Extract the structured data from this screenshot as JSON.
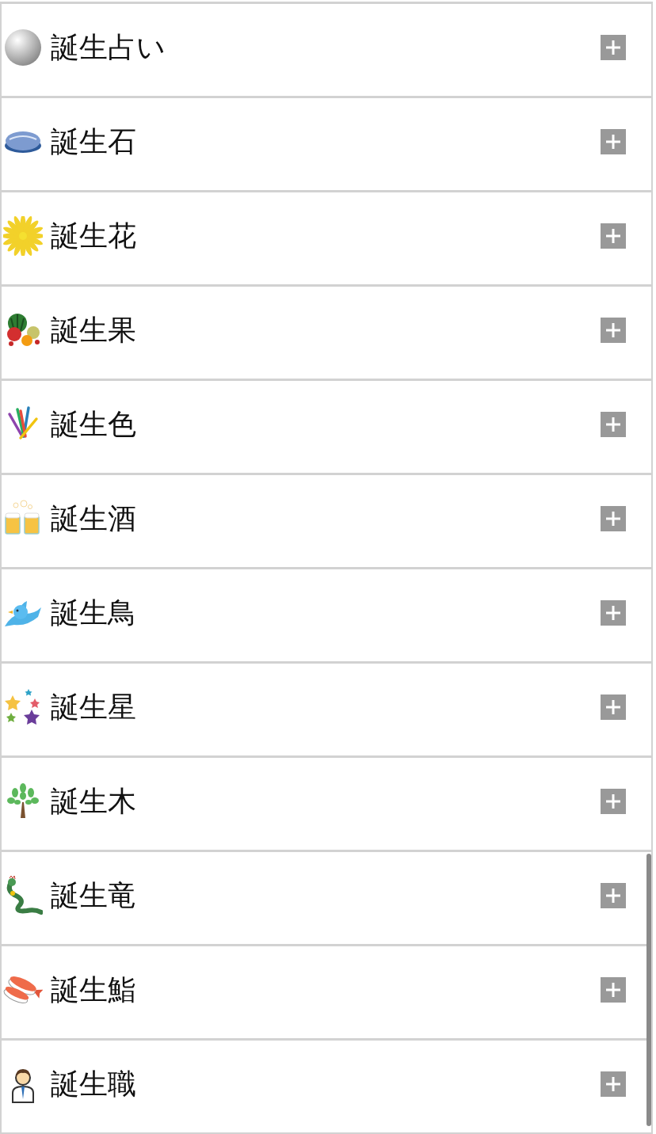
{
  "items": [
    {
      "label": "誕生占い",
      "expanded": false
    },
    {
      "label": "誕生石",
      "expanded": false
    },
    {
      "label": "誕生花",
      "expanded": false
    },
    {
      "label": "誕生果",
      "expanded": false
    },
    {
      "label": "誕生色",
      "expanded": false
    },
    {
      "label": "誕生酒",
      "expanded": false
    },
    {
      "label": "誕生鳥",
      "expanded": false
    },
    {
      "label": "誕生星",
      "expanded": false
    },
    {
      "label": "誕生木",
      "expanded": false
    },
    {
      "label": "誕生竜",
      "expanded": false
    },
    {
      "label": "誕生鮨",
      "expanded": false
    },
    {
      "label": "誕生職",
      "expanded": false
    }
  ]
}
